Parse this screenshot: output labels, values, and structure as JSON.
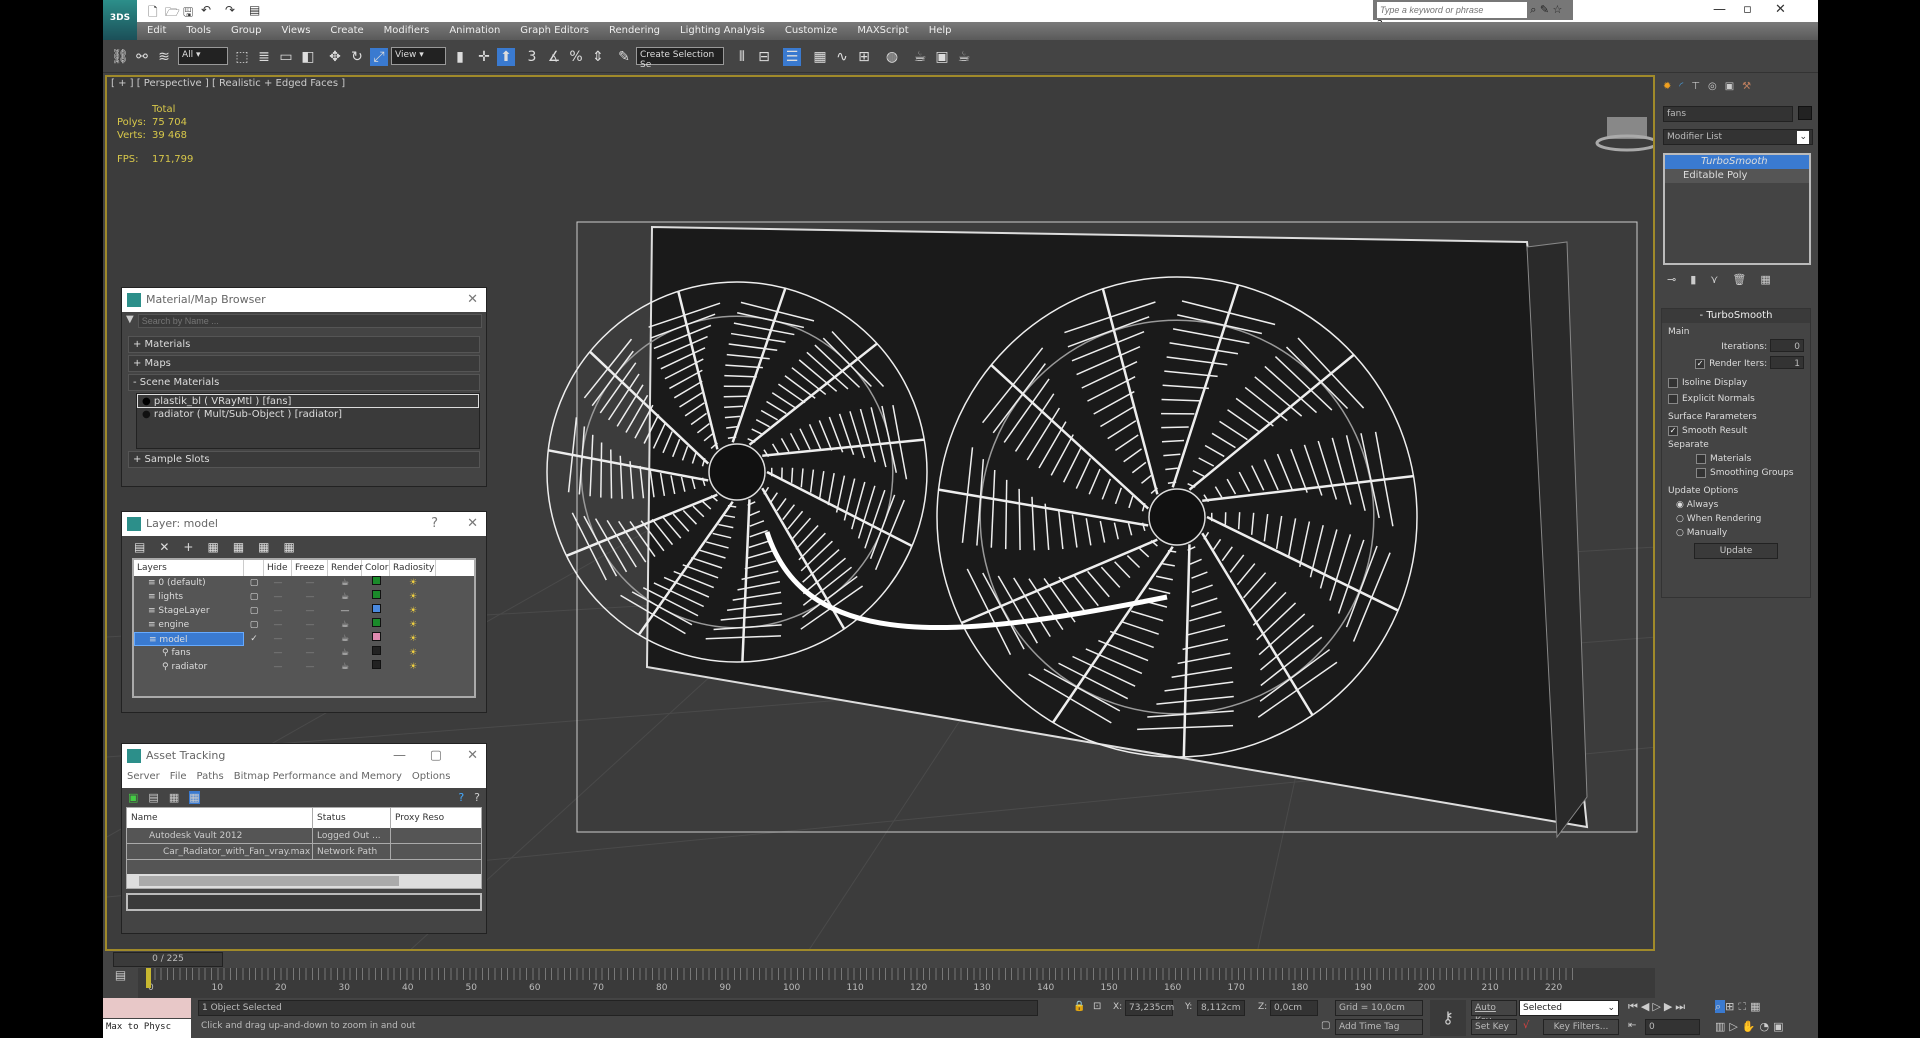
{
  "app": {
    "logo": "3DS",
    "search_placeholder": "Type a keyword or phrase"
  },
  "menu": [
    "Edit",
    "Tools",
    "Group",
    "Views",
    "Create",
    "Modifiers",
    "Animation",
    "Graph Editors",
    "Rendering",
    "Lighting Analysis",
    "Customize",
    "MAXScript",
    "Help"
  ],
  "toolbar": {
    "filter": "All",
    "ref_coord": "View",
    "selection_set": "Create Selection Se",
    "snap_angle": "3"
  },
  "viewport": {
    "label": "[ + ] [ Perspective ] [ Realistic + Edged Faces ]",
    "stats_header": "Total",
    "polys_label": "Polys:",
    "polys": "75 704",
    "verts_label": "Verts:",
    "verts": "39 468",
    "fps_label": "FPS:",
    "fps": "171,799"
  },
  "material_browser": {
    "title": "Material/Map Browser",
    "search_placeholder": "Search by Name ...",
    "materials": "+ Materials",
    "maps": "+ Maps",
    "scene_materials": "- Scene Materials",
    "items": [
      "plastik_bl  ( VRayMtl )  [fans]",
      "radiator  ( Mult/Sub-Object )  [radiator]"
    ],
    "sample_slots": "+ Sample Slots"
  },
  "layer_panel": {
    "title": "Layer: model",
    "help": "?",
    "columns": [
      "Layers",
      "",
      "Hide",
      "Freeze",
      "Render",
      "Color",
      "Radiosity"
    ],
    "rows": [
      {
        "name": "0 (default)",
        "color": "#1a8a2a"
      },
      {
        "name": "lights",
        "color": "#1a8a2a"
      },
      {
        "name": "StageLayer",
        "color": "#4a8ae0"
      },
      {
        "name": "engine",
        "color": "#1a8a2a"
      },
      {
        "name": "model",
        "color": "#e08ab0"
      },
      {
        "name": "fans",
        "color": "#222222"
      },
      {
        "name": "radiator",
        "color": "#222222"
      }
    ]
  },
  "asset_tracking": {
    "title": "Asset Tracking",
    "menu": [
      "Server",
      "File",
      "Paths",
      "Bitmap Performance and Memory",
      "Options"
    ],
    "columns": [
      "Name",
      "Status",
      "Proxy Reso"
    ],
    "rows": [
      {
        "name": "Autodesk Vault 2012",
        "status": "Logged Out ..."
      },
      {
        "name": "Car_Radiator_with_Fan_vray.max",
        "status": "Network Path"
      }
    ]
  },
  "command_panel": {
    "object_name": "fans",
    "modifier_list": "Modifier List",
    "stack": [
      "TurboSmooth",
      "Editable Poly"
    ],
    "rollout": "TurboSmooth",
    "main": "Main",
    "iterations_label": "Iterations:",
    "iterations": "0",
    "render_iters_label": "Render Iters:",
    "render_iters": "1",
    "isoline": "Isoline Display",
    "explicit": "Explicit Normals",
    "surface": "Surface Parameters",
    "smooth_result": "Smooth Result",
    "separate": "Separate",
    "materials": "Materials",
    "smoothing_groups": "Smoothing Groups",
    "update_options": "Update Options",
    "always": "Always",
    "when_rendering": "When Rendering",
    "manually": "Manually",
    "update": "Update"
  },
  "timeline": {
    "frame": "0 / 225",
    "ticks": [
      "0",
      "10",
      "20",
      "30",
      "40",
      "50",
      "60",
      "70",
      "80",
      "90",
      "100",
      "110",
      "120",
      "130",
      "140",
      "150",
      "160",
      "170",
      "180",
      "190",
      "200",
      "210",
      "220"
    ]
  },
  "status": {
    "maxscript": "Max to Physc",
    "selected": "1 Object Selected",
    "prompt": "Click and drag up-and-down to zoom in and out",
    "x_label": "X:",
    "x": "73,235cm",
    "y_label": "Y:",
    "y": "8,112cm",
    "z_label": "Z:",
    "z": "0,0cm",
    "grid": "Grid = 10,0cm",
    "add_time_tag": "Add Time Tag",
    "auto_key": "Auto Key",
    "selected_dropdown": "Selected",
    "set_key": "Set Key",
    "key_filters": "Key Filters...",
    "current_frame": "0"
  }
}
